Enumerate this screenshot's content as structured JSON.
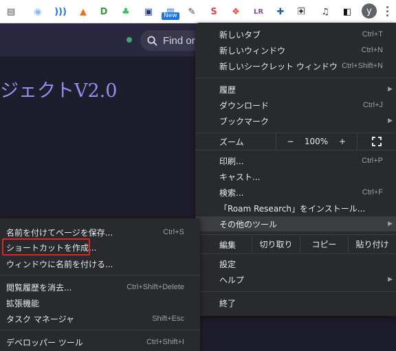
{
  "toolbar": {
    "extensions": [
      {
        "name": "clipboard-icon",
        "glyph": "▤",
        "color": "#555555"
      },
      {
        "name": "record-icon",
        "glyph": "◉",
        "color": "#8ab4f8"
      },
      {
        "name": "wifi-signal-icon",
        "glyph": ")))",
        "color": "#1a73e8"
      },
      {
        "name": "metamask-fox-icon",
        "glyph": "▲",
        "color": "#e2761b"
      },
      {
        "name": "d-logo-icon",
        "glyph": "D",
        "color": "#2e9e3e"
      },
      {
        "name": "evernote-icon",
        "glyph": "♣",
        "color": "#2dbe60"
      },
      {
        "name": "screenshot-icon",
        "glyph": "▣",
        "color": "#1a3a8f"
      },
      {
        "name": "capture-new-icon",
        "glyph": "▥",
        "color": "#1a73e8"
      },
      {
        "name": "brush-icon",
        "glyph": "✎",
        "color": "#444444"
      },
      {
        "name": "s-logo-icon",
        "glyph": "S",
        "color": "#e04646"
      },
      {
        "name": "fire-icon",
        "glyph": "❖",
        "color": "#e8432e"
      },
      {
        "name": "lr-icon",
        "glyph": "LR",
        "color": "#8e44ad"
      },
      {
        "name": "network-icon",
        "glyph": "✚",
        "color": "#1a5f9e"
      },
      {
        "name": "window-icon",
        "glyph": "❐",
        "color": "#666666"
      },
      {
        "name": "puzzle-icon",
        "glyph": "✦",
        "color": "#333333"
      },
      {
        "name": "media-icon",
        "glyph": "♫",
        "color": "#333333"
      },
      {
        "name": "side-panel-icon",
        "glyph": "◧",
        "color": "#111111"
      }
    ],
    "new_badge": "New",
    "avatar_letter": "y"
  },
  "page": {
    "search_text": "Find or",
    "title": "ジェクトV2.0"
  },
  "menu": {
    "items": {
      "new_tab": {
        "label": "新しいタブ",
        "shortcut": "Ctrl+T"
      },
      "new_window": {
        "label": "新しいウィンドウ",
        "shortcut": "Ctrl+N"
      },
      "new_incognito": {
        "label": "新しいシークレット ウィンドウ",
        "shortcut": "Ctrl+Shift+N"
      },
      "history": {
        "label": "履歴"
      },
      "downloads": {
        "label": "ダウンロード",
        "shortcut": "Ctrl+J"
      },
      "bookmarks": {
        "label": "ブックマーク"
      },
      "print": {
        "label": "印刷...",
        "shortcut": "Ctrl+P"
      },
      "cast": {
        "label": "キャスト..."
      },
      "find": {
        "label": "検索...",
        "shortcut": "Ctrl+F"
      },
      "install": {
        "label": "「Roam Research」をインストール..."
      },
      "more_tools": {
        "label": "その他のツール"
      },
      "settings": {
        "label": "設定"
      },
      "help": {
        "label": "ヘルプ"
      },
      "exit": {
        "label": "終了"
      }
    },
    "zoom": {
      "label": "ズーム",
      "minus": "−",
      "value": "100%",
      "plus": "+"
    },
    "edit": {
      "label": "編集",
      "cut": "切り取り",
      "copy": "コピー",
      "paste": "貼り付け"
    }
  },
  "submenu": {
    "save_page": {
      "label": "名前を付けてページを保存...",
      "shortcut": "Ctrl+S"
    },
    "create_shortcut": {
      "label": "ショートカットを作成..."
    },
    "name_window": {
      "label": "ウィンドウに名前を付ける..."
    },
    "clear_data": {
      "label": "閲覧履歴を消去...",
      "shortcut": "Ctrl+Shift+Delete"
    },
    "extensions": {
      "label": "拡張機能"
    },
    "task_manager": {
      "label": "タスク マネージャ",
      "shortcut": "Shift+Esc"
    },
    "dev_tools": {
      "label": "デベロッパー ツール",
      "shortcut": "Ctrl+Shift+I"
    }
  },
  "colors": {
    "menu_bg": "#292a2d",
    "highlight": "#3c3d41",
    "title_accent": "#9a8cf0",
    "annotation_red": "#e02424"
  }
}
